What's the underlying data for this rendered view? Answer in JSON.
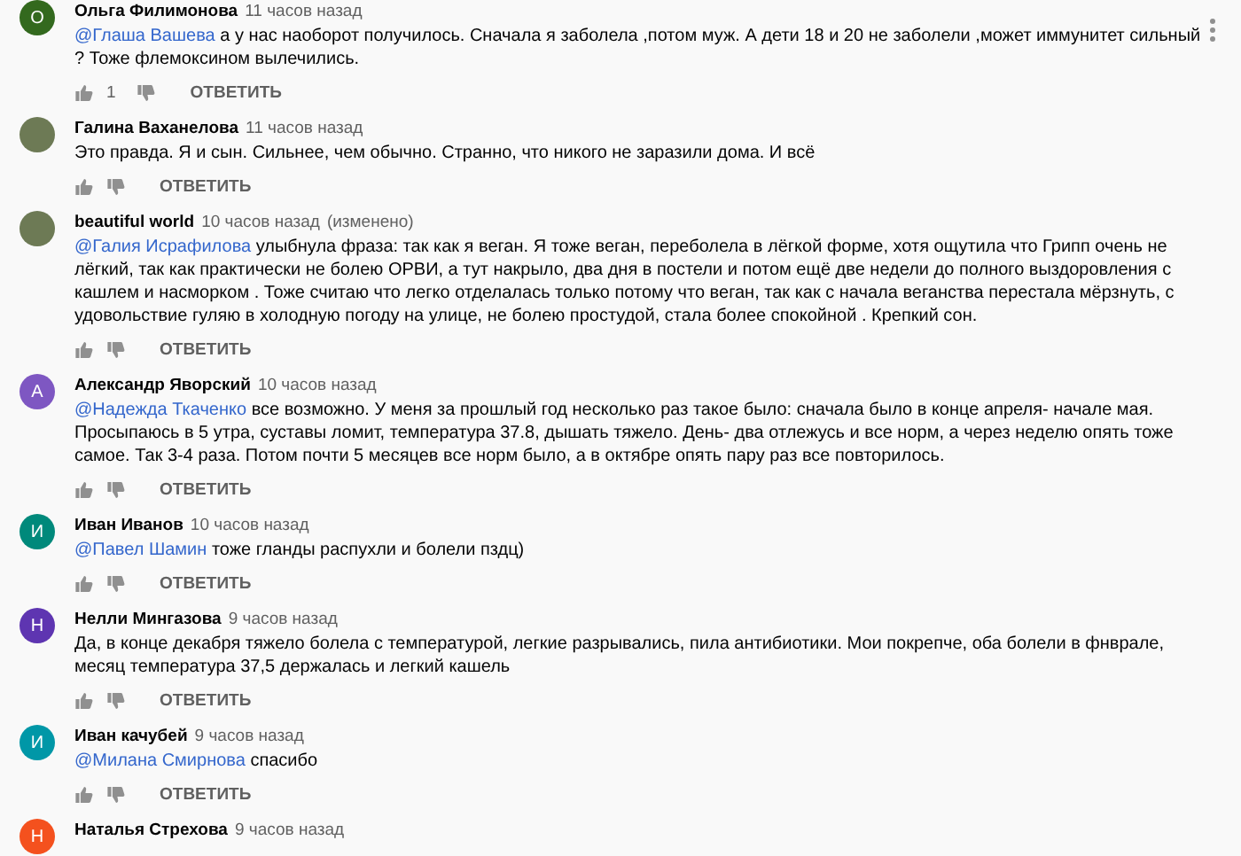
{
  "comments": [
    {
      "author": "Ольга Филимонова",
      "time": "11 часов назад",
      "avatar": {
        "kind": "letter",
        "letter": "О",
        "color": "#33691e"
      },
      "mention": "@Глаша Вашева",
      "text": "а у нас наоборот получилось. Сначала я заболела ,потом муж. А дети 18 и 20 не заболели ,может иммунитет сильный ? Тоже флемоксином вылечились.",
      "likes": "1",
      "reply": "ОТВЕТИТЬ",
      "menu": true
    },
    {
      "author": "Галина Ваханелова",
      "time": "11 часов назад",
      "avatar": {
        "kind": "photo"
      },
      "text": "Это правда. Я и сын. Сильнее, чем обычно. Странно, что никого не заразили дома. И всё",
      "reply": "ОТВЕТИТЬ",
      "menu": false
    },
    {
      "author": "beautiful world",
      "time": "10 часов назад",
      "edited": "(изменено)",
      "avatar": {
        "kind": "photo"
      },
      "mention": "@Галия Исрафилова",
      "text": "улыбнула фраза: так как я веган. Я тоже веган, переболела в лёгкой форме, хотя ощутила что Грипп очень не лёгкий, так как практически не болею ОРВИ, а тут накрыло, два дня в постели и потом ещё две недели до полного выздоровления с кашлем и  насморком .  Тоже считаю что легко отделалась только потому что веган, так как с начала веганства перестала мёрзнуть, с удовольствие гуляю в холодную погоду на улице,  не болею простудой, стала более спокойной . Крепкий сон.",
      "reply": "ОТВЕТИТЬ",
      "menu": false
    },
    {
      "author": "Александр Яворский",
      "time": "10 часов назад",
      "avatar": {
        "kind": "letter",
        "letter": "А",
        "color": "#7e57c2"
      },
      "mention": "@Надежда Ткаченко",
      "text": "все возможно.  У меня за прошлый год несколько раз такое было:  сначала было в конце апреля- начале мая. Просыпаюсь в 5 утра,  суставы ломит,  температура 37.8, дышать тяжело.  День- два отлежусь и все норм,  а через неделю опять тоже самое.  Так 3-4 раза.  Потом почти 5 месяцев все норм было,  а в октябре опять пару раз все повторилось.",
      "reply": "ОТВЕТИТЬ",
      "menu": false
    },
    {
      "author": "Иван Иванов",
      "time": "10 часов назад",
      "avatar": {
        "kind": "letter",
        "letter": "И",
        "color": "#00897b"
      },
      "mention": "@Павел Шамин",
      "text": "тоже гланды распухли и болели пздц)",
      "reply": "ОТВЕТИТЬ",
      "menu": false
    },
    {
      "author": "Нелли Мингазова",
      "time": "9 часов назад",
      "avatar": {
        "kind": "letter",
        "letter": "Н",
        "color": "#5e35b1"
      },
      "text": "Да, в конце декабря тяжело болела с температурой, легкие разрывались, пила антибиотики. Мои покрепче, оба болели в фнврале, месяц температура 37,5  держалась и легкий кашель",
      "reply": "ОТВЕТИТЬ",
      "menu": false
    },
    {
      "author": "Иван качубей",
      "time": "9 часов назад",
      "avatar": {
        "kind": "letter",
        "letter": "И",
        "color": "#0097a7"
      },
      "mention": "@Милана Смирнова",
      "text": "спасибо",
      "reply": "ОТВЕТИТЬ",
      "menu": false
    },
    {
      "author": "Наталья Стрехова",
      "time": "9 часов назад",
      "avatar": {
        "kind": "letter",
        "letter": "Н",
        "color": "#f4511e"
      }
    }
  ]
}
